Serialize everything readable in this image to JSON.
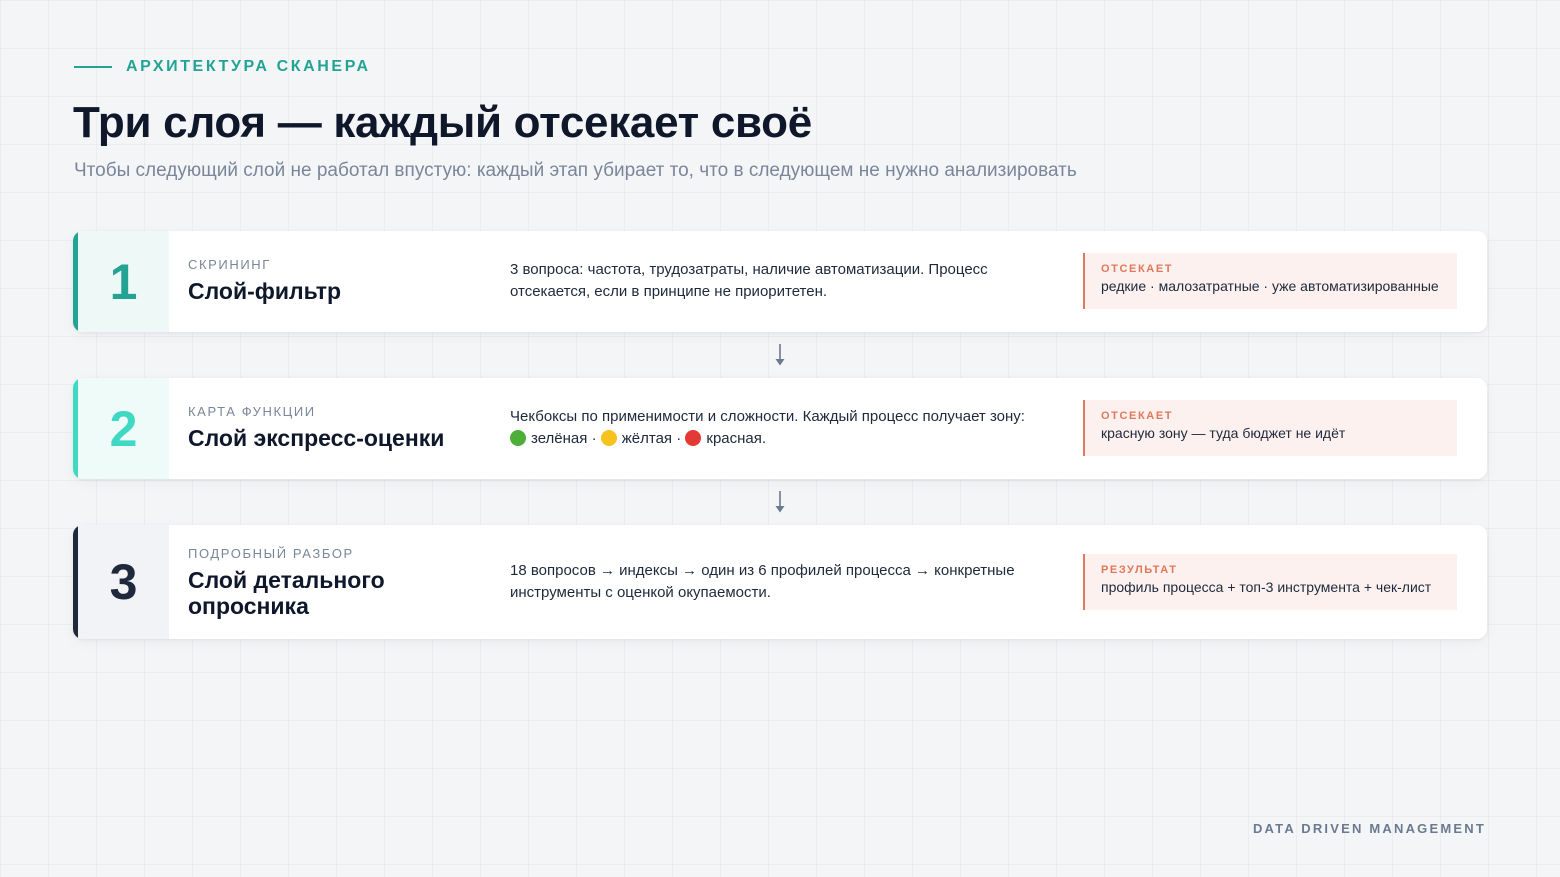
{
  "header": {
    "eyebrow": "АРХИТЕКТУРА СКАНЕРА",
    "title": "Три слоя — каждый отсекает своё",
    "subtitle": "Чтобы следующий слой не работал впустую: каждый этап убирает то, что в следующем не нужно анализировать"
  },
  "layers": [
    {
      "number": "1",
      "kicker": "СКРИНИНГ",
      "name": "Слой-фильтр",
      "description": "3 вопроса: частота, трудозатраты, наличие автоматизации. Процесс отсекается, если в принципе не приоритетен.",
      "badge_label": "ОТСЕКАЕТ",
      "badge_text": "редкие · малозатратные · уже автоматизированные",
      "accent": "#22a393"
    },
    {
      "number": "2",
      "kicker": "КАРТА ФУНКЦИИ",
      "name": "Слой экспресс-оценки",
      "description_line1": "Чекбоксы по применимости и сложности. Каждый процесс получает зону:",
      "zone_green": "зелёная",
      "zone_yellow": "жёлтая",
      "zone_red": "красная.",
      "badge_label": "ОТСЕКАЕТ",
      "badge_text": "красную зону — туда бюджет не идёт",
      "accent": "#3fd9c3"
    },
    {
      "number": "3",
      "kicker": "ПОДРОБНЫЙ РАЗБОР",
      "name": "Слой детального опросника",
      "description": "18 вопросов → индексы → один из 6 профилей процесса → конкретные инструменты с оценкой окупаемости.",
      "badge_label": "РЕЗУЛЬТАТ",
      "badge_text": "профиль процесса + топ-3 инструмента + чек-лист",
      "accent": "#1e293b"
    }
  ],
  "separator": " · ",
  "footer": {
    "brand": "DATA DRIVEN MANAGEMENT"
  },
  "colors": {
    "teal": "#22a393",
    "mint": "#3fd9c3",
    "navy": "#1e293b",
    "cutoff": "#e0785a"
  },
  "icons": {
    "flow_arrow": "arrow-down-icon"
  }
}
